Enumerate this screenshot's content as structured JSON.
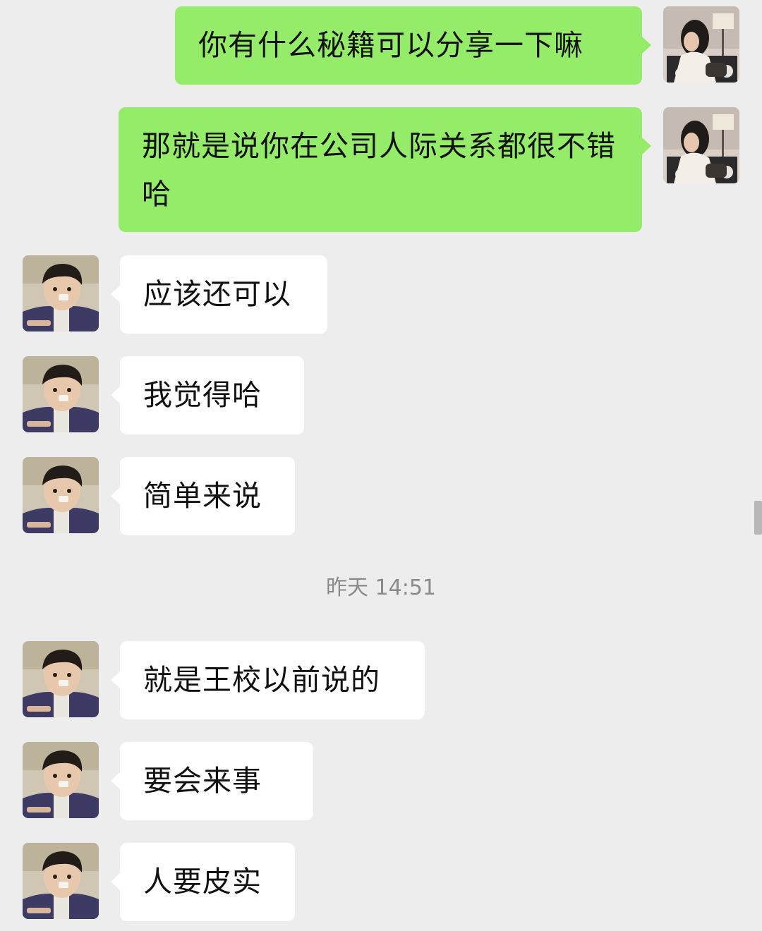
{
  "conversation": {
    "messages": [
      {
        "sender": "me",
        "text": "你有什么秘籍可以分享一下嘛"
      },
      {
        "sender": "me",
        "text": "那就是说你在公司人际关系都很不错哈"
      },
      {
        "sender": "other",
        "text": "应该还可以"
      },
      {
        "sender": "other",
        "text": "我觉得哈"
      },
      {
        "sender": "other",
        "text": "简单来说"
      },
      {
        "sender": "other",
        "text": "就是王校以前说的"
      },
      {
        "sender": "other",
        "text": "要会来事"
      },
      {
        "sender": "other",
        "text": "人要皮实"
      }
    ],
    "timestamp": "昨天 14:51"
  },
  "colors": {
    "background": "#ededed",
    "outgoing_bubble": "#95ec69",
    "incoming_bubble": "#ffffff",
    "timestamp_text": "#8a8a8a"
  },
  "icons": {
    "my_avatar": "girl-photo-avatar",
    "contact_avatar": "boy-photo-avatar"
  }
}
